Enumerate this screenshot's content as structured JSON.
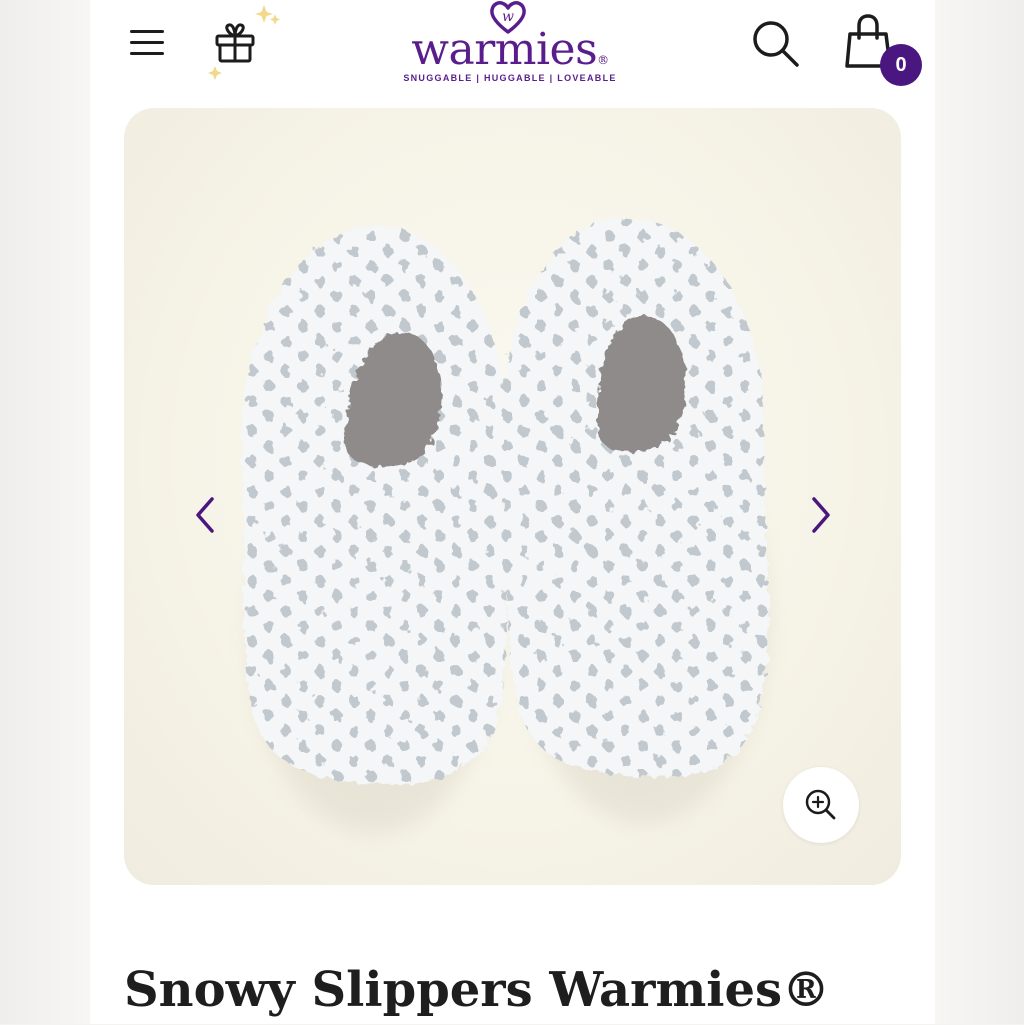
{
  "header": {
    "menu_icon": "hamburger-menu-icon",
    "gift_icon": "gift-icon",
    "search_icon": "search-icon",
    "cart_icon": "shopping-bag-icon",
    "cart_count": "0"
  },
  "logo": {
    "wordmark": "warmies",
    "registered": "®",
    "tagline": "SNUGGABLE | HUGGABLE | LOVEABLE",
    "heart_letter": "w"
  },
  "gallery": {
    "prev_icon": "chevron-left-icon",
    "next_icon": "chevron-right-icon",
    "zoom_icon": "zoom-in-icon"
  },
  "product": {
    "title": "Snowy Slippers Warmies®"
  },
  "colors": {
    "brand_purple": "#5a1e8c",
    "badge_purple": "#4a1680",
    "image_bg": "#f6f3e7",
    "sparkle_gold": "#f2d98a"
  }
}
